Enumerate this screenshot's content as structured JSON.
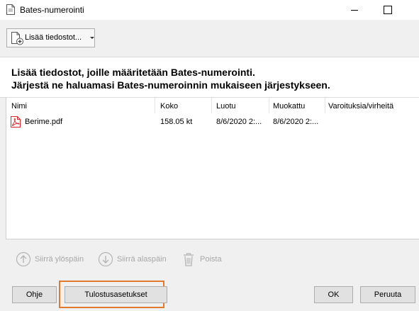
{
  "window": {
    "title": "Bates-numerointi"
  },
  "toolbar": {
    "add_files_label": "Lisää tiedostot..."
  },
  "instructions": {
    "line1": "Lisää tiedostot, joille määritetään Bates-numerointi.",
    "line2": "Järjestä ne haluamasi Bates-numeroinnin mukaiseen järjestykseen."
  },
  "file_list": {
    "columns": [
      "Nimi",
      "Koko",
      "Luotu",
      "Muokattu",
      "Varoituksia/virheitä"
    ],
    "rows": [
      {
        "name": "Berime.pdf",
        "size": "158.05 kt",
        "created": "8/6/2020 2:...",
        "modified": "8/6/2020 2:...",
        "warnings": ""
      }
    ]
  },
  "actions": {
    "move_up": "Siirrä ylöspäin",
    "move_down": "Siirrä alaspäin",
    "remove": "Poista"
  },
  "buttons": {
    "help": "Ohje",
    "print_settings": "Tulostusasetukset",
    "ok": "OK",
    "cancel": "Peruuta"
  },
  "colors": {
    "highlight": "#e07a2f",
    "pdf_red": "#d9262a",
    "disabled": "#a8a8a8"
  },
  "icons": [
    "document-icon",
    "add-document-icon",
    "pdf-icon",
    "arrow-up-icon",
    "arrow-down-icon",
    "trash-icon"
  ]
}
